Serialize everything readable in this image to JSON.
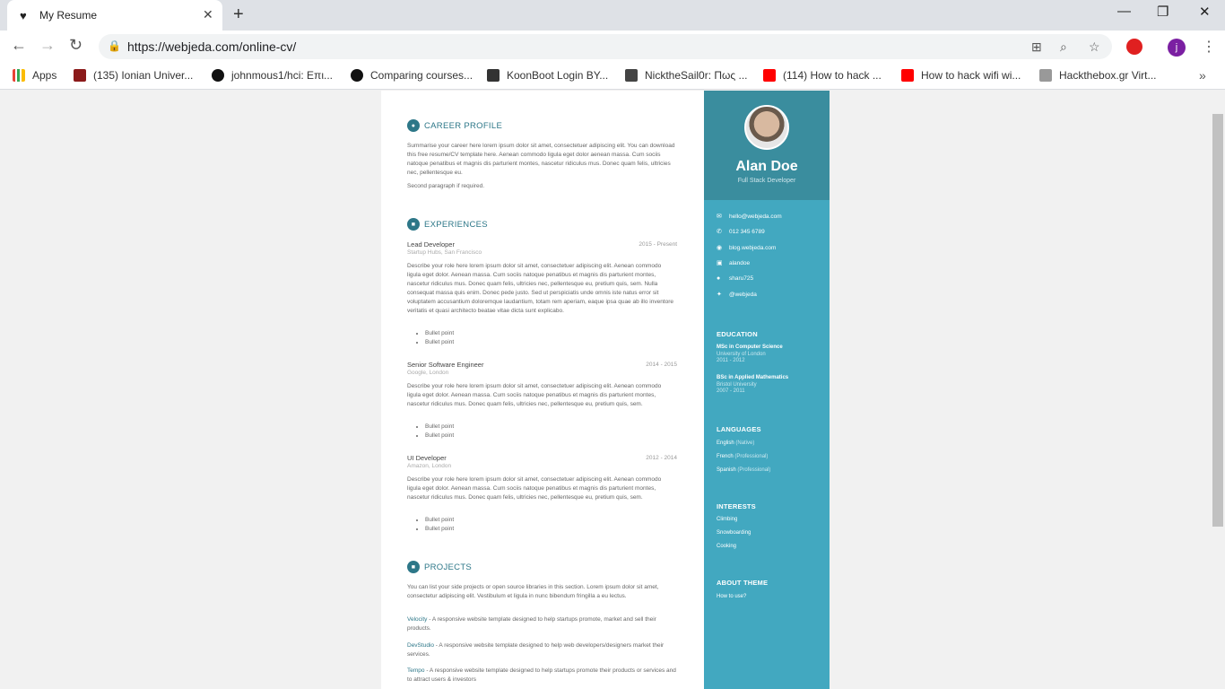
{
  "browser": {
    "tab_title": "My Resume",
    "url": "https://webjeda.com/online-cv/",
    "bookmarks": [
      {
        "label": "Apps",
        "icon": "apps-grid-icon"
      },
      {
        "label": "(135) Ionian Univer...",
        "icon": "university-icon"
      },
      {
        "label": "johnmous1/hci: Επι...",
        "icon": "github-icon"
      },
      {
        "label": "Comparing courses...",
        "icon": "github-icon"
      },
      {
        "label": "KoonBoot Login BY...",
        "icon": "site-icon"
      },
      {
        "label": "NicktheSail0r: Πως ...",
        "icon": "site-icon"
      },
      {
        "label": "(114) How to hack ...",
        "icon": "youtube-icon"
      },
      {
        "label": "How to hack wifi wi...",
        "icon": "youtube-icon"
      },
      {
        "label": "Hackthebox.gr Virt...",
        "icon": "hackthebox-icon"
      }
    ],
    "profile_initial": "j"
  },
  "resume": {
    "name": "Alan Doe",
    "tagline": "Full Stack Developer",
    "contact": [
      {
        "icon": "mail-icon",
        "text": "hello@webjeda.com"
      },
      {
        "icon": "phone-icon",
        "text": "012 345 6789"
      },
      {
        "icon": "globe-icon",
        "text": "blog.webjeda.com"
      },
      {
        "icon": "linkedin-icon",
        "text": "alandoe"
      },
      {
        "icon": "github-icon",
        "text": "sharu725"
      },
      {
        "icon": "twitter-icon",
        "text": "@webjeda"
      }
    ],
    "education_title": "EDUCATION",
    "education": [
      {
        "degree": "MSc in Computer Science",
        "school": "University of London",
        "years": "2011 - 2012"
      },
      {
        "degree": "BSc in Applied Mathematics",
        "school": "Bristol University",
        "years": "2007 - 2011"
      }
    ],
    "languages_title": "LANGUAGES",
    "languages": [
      {
        "name": "English",
        "level": "(Native)"
      },
      {
        "name": "French",
        "level": "(Professional)"
      },
      {
        "name": "Spanish",
        "level": "(Professional)"
      }
    ],
    "interests_title": "INTERESTS",
    "interests": [
      "Climbing",
      "Snowboarding",
      "Cooking"
    ],
    "about_title": "ABOUT THEME",
    "about_link": "How to use?",
    "career_title": "CAREER PROFILE",
    "career_p1": "Summarise your career here lorem ipsum dolor sit amet, consectetuer adipiscing elit. You can download this free resume/CV template here. Aenean commodo ligula eget dolor aenean massa. Cum sociis natoque penatibus et magnis dis parturient montes, nascetur ridiculus mus. Donec quam felis, ultricies nec, pellentesque eu.",
    "career_p2": "Second paragraph if required.",
    "experiences_title": "EXPERIENCES",
    "jobs": [
      {
        "title": "Lead Developer",
        "date": "2015 - Present",
        "company": "Startup Hubs, San Francisco",
        "desc": "Describe your role here lorem ipsum dolor sit amet, consectetuer adipiscing elit. Aenean commodo ligula eget dolor. Aenean massa. Cum sociis natoque penatibus et magnis dis parturient montes, nascetur ridiculus mus. Donec quam felis, ultricies nec, pellentesque eu, pretium quis, sem. Nulla consequat massa quis enim. Donec pede justo. Sed ut perspiciatis unde omnis iste natus error sit voluptatem accusantium doloremque laudantium, totam rem aperiam, eaque ipsa quae ab illo inventore veritatis et quasi architecto beatae vitae dicta sunt explicabo.",
        "bullets": [
          "Bullet point",
          "Bullet point"
        ]
      },
      {
        "title": "Senior Software Engineer",
        "date": "2014 - 2015",
        "company": "Google, London",
        "desc": "Describe your role here lorem ipsum dolor sit amet, consectetuer adipiscing elit. Aenean commodo ligula eget dolor. Aenean massa. Cum sociis natoque penatibus et magnis dis parturient montes, nascetur ridiculus mus. Donec quam felis, ultricies nec, pellentesque eu, pretium quis, sem.",
        "bullets": [
          "Bullet point",
          "Bullet point"
        ]
      },
      {
        "title": "UI Developer",
        "date": "2012 - 2014",
        "company": "Amazon, London",
        "desc": "Describe your role here lorem ipsum dolor sit amet, consectetuer adipiscing elit. Aenean commodo ligula eget dolor. Aenean massa. Cum sociis natoque penatibus et magnis dis parturient montes, nascetur ridiculus mus. Donec quam felis, ultricies nec, pellentesque eu, pretium quis, sem.",
        "bullets": [
          "Bullet point",
          "Bullet point"
        ]
      }
    ],
    "projects_title": "PROJECTS",
    "projects_intro": "You can list your side projects or open source libraries in this section. Lorem ipsum dolor sit amet, consectetur adipiscing elit. Vestibulum et ligula in nunc bibendum fringilla a eu lectus.",
    "projects": [
      {
        "name": "Velocity",
        "desc": " - A responsive website template designed to help startups promote, market and sell their products."
      },
      {
        "name": "DevStudio",
        "desc": " - A responsive website template designed to help web developers/designers market their services."
      },
      {
        "name": "Tempo",
        "desc": " - A responsive website template designed to help startups promote their products or services and to attract users & investors"
      }
    ]
  }
}
